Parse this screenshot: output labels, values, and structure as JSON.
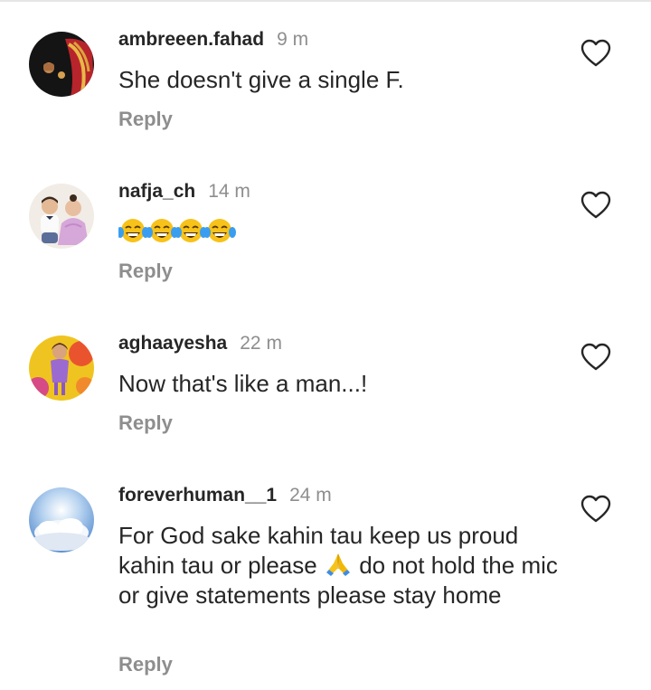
{
  "comments": [
    {
      "username": "ambreeen.fahad",
      "time": "9 m",
      "text": "She doesn't give a single F.",
      "reply": "Reply"
    },
    {
      "username": "nafja_ch",
      "time": "14 m",
      "text": "😂😂😂😂",
      "reply": "Reply"
    },
    {
      "username": "aghaayesha",
      "time": "22 m",
      "text": "Now that's like a man...!",
      "reply": "Reply"
    },
    {
      "username": "foreverhuman__1",
      "time": "24 m",
      "text_before": "For God sake kahin tau keep us proud kahin tau or please",
      "text_emoji": "🙏",
      "text_after": "do not hold the mic or give statements please stay home",
      "reply": "Reply"
    }
  ],
  "icons": {
    "like": "heart-outline-icon",
    "reaction": "tears-of-joy-emoji",
    "prayer": "folded-hands-emoji"
  },
  "colors": {
    "text": "#262626",
    "secondary": "#8e8e8e",
    "emoji_face": "#f7c21a"
  }
}
